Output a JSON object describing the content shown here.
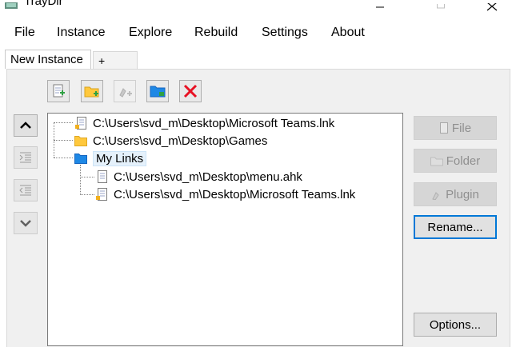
{
  "window": {
    "title": "TrayDir"
  },
  "menu": [
    "File",
    "Instance",
    "Explore",
    "Rebuild",
    "Settings",
    "About"
  ],
  "tabs": {
    "active": "New Instance",
    "add": "+"
  },
  "tree": {
    "items": [
      {
        "label": "C:\\Users\\svd_m\\Desktop\\Microsoft Teams.lnk",
        "icon": "file-icon"
      },
      {
        "label": "C:\\Users\\svd_m\\Desktop\\Games",
        "icon": "folder-icon"
      },
      {
        "label": "My Links",
        "icon": "blue-folder-icon"
      },
      {
        "label": "C:\\Users\\svd_m\\Desktop\\menu.ahk",
        "icon": "file-icon"
      },
      {
        "label": "C:\\Users\\svd_m\\Desktop\\Microsoft Teams.lnk",
        "icon": "file-icon"
      }
    ]
  },
  "buttons": {
    "file": "File",
    "folder": "Folder",
    "plugin": "Plugin",
    "rename": "Rename...",
    "options": "Options..."
  },
  "colors": {
    "accent": "#0078d7",
    "delete": "#e81123",
    "folder": "#ffc83d",
    "blue_folder": "#1e88e5"
  }
}
